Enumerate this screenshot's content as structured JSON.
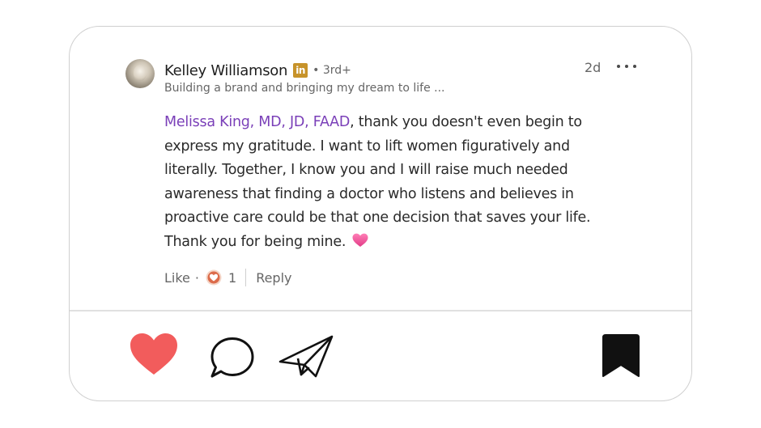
{
  "post": {
    "author_name": "Kelley Williamson",
    "badge": "in",
    "degree": "• 3rd+",
    "headline": "Building a brand and bringing my dream to life ...",
    "time": "2d",
    "mention": "Melissa King, MD, JD, FAAD",
    "body_lines": [
      ", thank you doesn't even begin to",
      "express my gratitude. I want to lift women figuratively and",
      "literally. Together, I know you and I will raise much needed",
      "awareness that finding a doctor who listens and believes in",
      "proactive care could be that one decision that saves your life.",
      "Thank you for being mine."
    ],
    "like_label": "Like",
    "separator": "·",
    "reaction_count": "1",
    "reply_label": "Reply"
  },
  "bottom_bar": {
    "icons": [
      "heart-icon",
      "comment-bubble-icon",
      "send-paper-plane-icon",
      "bookmark-icon"
    ]
  },
  "colors": {
    "mention": "#7a3fb8",
    "heart": "#f25c5c",
    "badge": "#c7932a",
    "muted_text": "#666666"
  }
}
